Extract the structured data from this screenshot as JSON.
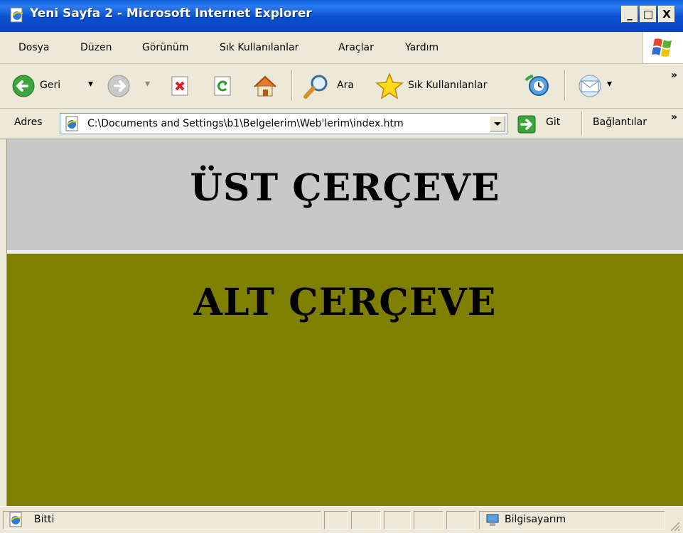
{
  "window": {
    "title": "Yeni Sayfa 2 - Microsoft Internet Explorer",
    "minimize": "_",
    "maximize": "□",
    "close": "X"
  },
  "menu": [
    "Dosya",
    "Düzen",
    "Görünüm",
    "Sık Kullanılanlar",
    "Araçlar",
    "Yardım"
  ],
  "toolbar": {
    "back_label": "Geri",
    "search_label": "Ara",
    "favorites_label": "Sık Kullanılanlar",
    "overflow": "»"
  },
  "address": {
    "label": "Adres",
    "value": "C:\\Documents and Settings\\b1\\Belgelerim\\Web'lerim\\index.htm",
    "go_label": "Git",
    "links_label": "Bağlantılar",
    "links_overflow": "»"
  },
  "frames": {
    "top_heading": "ÜST ÇERÇEVE",
    "bottom_heading": "ALT ÇERÇEVE",
    "top_bg": "#c8c8c8",
    "bottom_bg": "#808000"
  },
  "status": {
    "text": "Bitti",
    "zone": "Bilgisayarım"
  }
}
